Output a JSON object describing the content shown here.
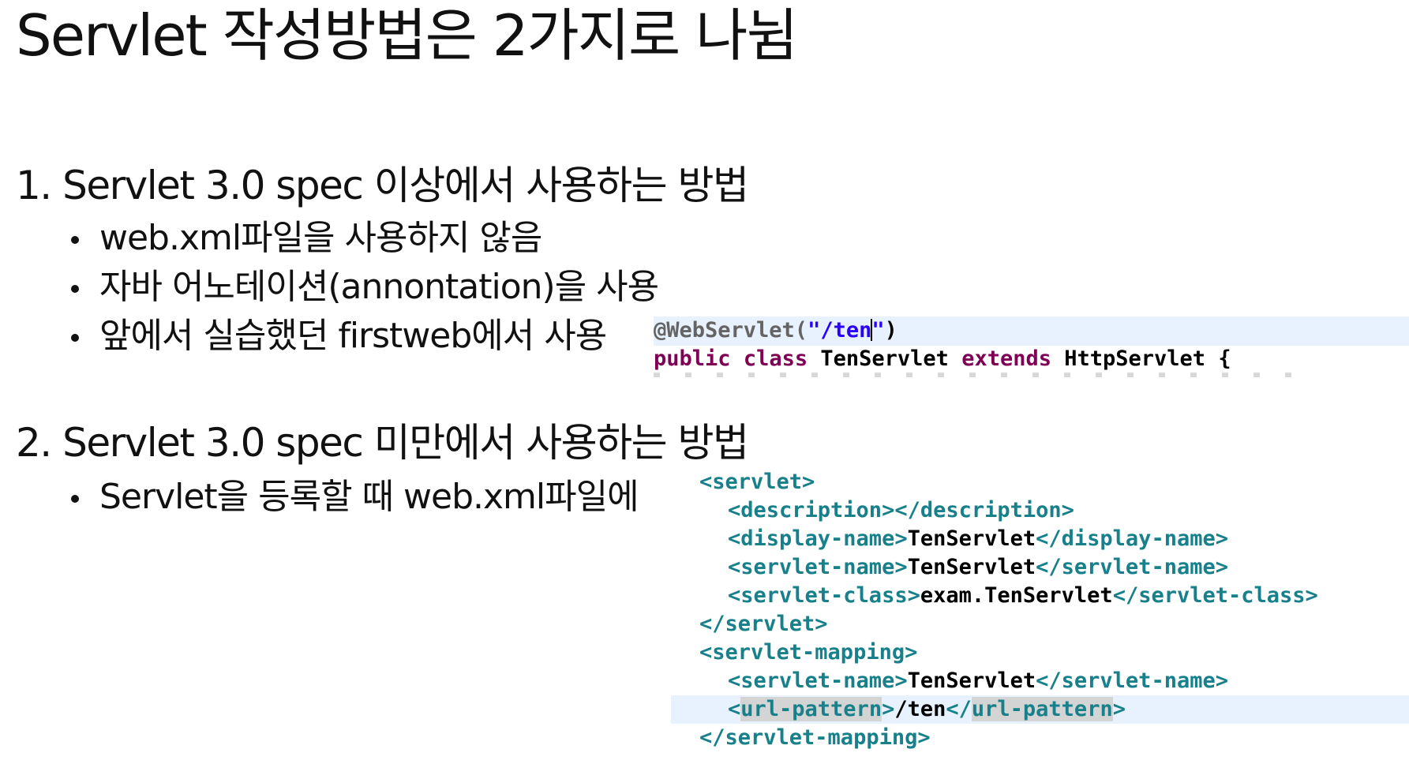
{
  "title": "Servlet 작성방법은 2가지로 나뉨",
  "section1": {
    "heading": "1. Servlet 3.0 spec 이상에서 사용하는 방법",
    "bullets": [
      "web.xml파일을 사용하지 않음",
      "자바 어노테이션(annontation)을 사용",
      "앞에서 실습했던 firstweb에서 사용"
    ]
  },
  "section2": {
    "heading": "2. Servlet 3.0 spec 미만에서 사용하는 방법",
    "bullets": [
      "Servlet을 등록할 때 web.xml파일에"
    ]
  },
  "java_code": {
    "annotation": "@WebServlet(",
    "path_before_caret": "\"/ten",
    "path_after_caret": "\"",
    "annotation_close": ")",
    "kw_public": "public",
    "kw_class": "class",
    "class_name": "TenServlet",
    "kw_extends": "extends",
    "super_class": "HttpServlet",
    "brace": "{"
  },
  "xml_code": {
    "servlet_open": "<servlet>",
    "description_open": "<description>",
    "description_close": "</description>",
    "display_name_open": "<display-name>",
    "display_name_value": "TenServlet",
    "display_name_close": "</display-name>",
    "servlet_name_open": "<servlet-name>",
    "servlet_name_value": "TenServlet",
    "servlet_name_close": "</servlet-name>",
    "servlet_class_open": "<servlet-class>",
    "servlet_class_value": "exam.TenServlet",
    "servlet_class_close": "</servlet-class>",
    "servlet_close": "</servlet>",
    "mapping_open": "<servlet-mapping>",
    "mapping_servlet_name_open": "<servlet-name>",
    "mapping_servlet_name_value": "TenServlet",
    "mapping_servlet_name_close": "</servlet-name>",
    "url_lt": "<",
    "url_open_name": "url-pattern",
    "url_gt": ">",
    "url_value": "/ten",
    "url_close_lt": "</",
    "url_close_name": "url-pattern",
    "url_close_gt": ">",
    "mapping_close": "</servlet-mapping>"
  },
  "colors": {
    "xml_tag": "#17808a",
    "java_keyword": "#7f0055",
    "java_string": "#2a00ff",
    "java_annotation": "#646464",
    "line_highlight": "#e8f2fe"
  }
}
